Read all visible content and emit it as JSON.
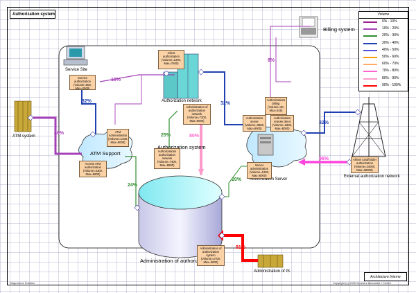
{
  "diagram": {
    "title": "Authorization system",
    "brand": "Architecture Interne",
    "footer_left": "Diagramme Solution",
    "footer_right": "Copyright (c) 2005 Sevestre Alexandre / Centre",
    "legend": {
      "title": "Volume",
      "items": [
        {
          "label": "0% - 10%",
          "color": "#9b1f8f"
        },
        {
          "label": "10% - 20%",
          "color": "#a540b8"
        },
        {
          "label": "20% - 30%",
          "color": "#2e8c2e"
        },
        {
          "label": "30% - 40%",
          "color": "#2040b0"
        },
        {
          "label": "40% - 50%",
          "color": "#5050e0"
        },
        {
          "label": "50% - 60%",
          "color": "#ff9900"
        },
        {
          "label": "60% - 70%",
          "color": "#ffaa66"
        },
        {
          "label": "70% - 80%",
          "color": "#ff66cc"
        },
        {
          "label": "80% - 90%",
          "color": "#ff99cc"
        },
        {
          "label": "90% - 100%",
          "color": "#ff0000"
        }
      ]
    },
    "nodes": {
      "billing": "Billing system",
      "atm": "ATM system",
      "atm_support": "ATM Support",
      "auth_system": "Authorization system",
      "auth_network": "Authorization network",
      "auth_server": "Authorization Server",
      "admin_db": "Administration of authorization",
      "admin_is": "Administration of IS",
      "external": "External authorization network",
      "service_site": "Service Site"
    },
    "boxes": {
      "service_auth": "Service authorization (Volume=800, Max=2500)",
      "client_auth": "Client authorization (Volume=1200, Max=7500)",
      "atm_admin": "ATM Administration (Volume=1400, Max=6000)",
      "atm_access": "Access ATM authorization (Volume=4300, Max=8800)",
      "network_auth": "Authorizations authorization network (Volume=7400, Max=8800)",
      "admin_network": "Administration of authorization network (Volume=7200, Max=9000)",
      "billing_auth": "Authorizations billing (Volume=30, Max=245)",
      "server_auth": "Authorization server (Volume=3600, Max=8000)",
      "remote_client": "Authorization remote client (Volume=1800, Max=8000)",
      "server_admin": "Server administration (Volume=1200, Max=8000)",
      "ext_auth": "Afrinet card/holder authorization (Volume=24000, Max=36000)",
      "admin_auth_system": "Administration of authorization system (Volume=2700, Max=3600)"
    },
    "percentages": {
      "p48": "48%",
      "p32a": "32%",
      "p16": "16%",
      "p8": "8%",
      "p32b": "32%",
      "p32c": "32%",
      "p25": "25%",
      "p80": "80%",
      "p24": "24%",
      "p20": "20%",
      "p96": "96%",
      "p91": "91%"
    }
  }
}
